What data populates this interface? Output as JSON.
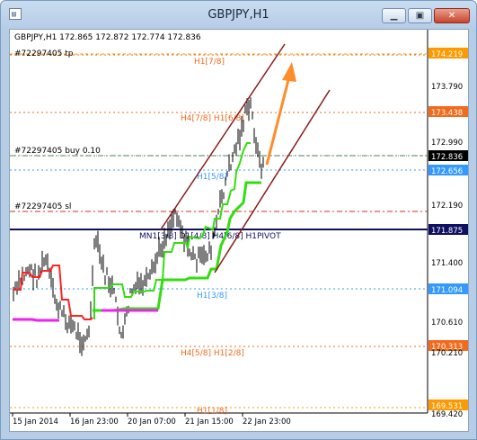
{
  "window": {
    "title": "GBPJPY,H1",
    "minimize_label": "▁",
    "maximize_label": "▣",
    "close_label": "✕",
    "icon": "chart-window-icon"
  },
  "chart": {
    "header": "GBPJPY,H1  172.865 172.872 172.774 172.836",
    "order_tp_label": "#72297405 tp",
    "order_buy_label": "#72297405 buy 0.10",
    "order_sl_label": "#72297405 sl",
    "murrey_labels": {
      "h1_7_8": "H1[7/8]",
      "h4_7_8_h1_6_8": "H4[7/8] H1[6/8]",
      "h1_5_8": "H1[5/8]",
      "mn1_pivot": "MN1[3/8] D1[4/8] H4[6/8] H1PIVOT",
      "h1_3_8": "H1[3/8]",
      "h4_5_8_h1_2_8": "H4[5/8] H1[2/8]",
      "h1_1_8": "H1[1/8]"
    },
    "price_axis": [
      "174.219",
      "173.790",
      "173.438",
      "172.990",
      "172.836",
      "172.656",
      "172.190",
      "171.875",
      "171.400",
      "171.094",
      "170.610",
      "170.313",
      "170.210",
      "169.531",
      "169.420"
    ],
    "time_axis": [
      "15 Jan 2014",
      "16 Jan 23:00",
      "20 Jan 07:00",
      "21 Jan 15:00",
      "22 Jan 23:00"
    ],
    "colors": {
      "tp_line": "#ff9900",
      "murrey_orange": "#f36a1c",
      "buy_line": "#2e8b2e",
      "current_price_line": "#808080",
      "current_price_tag": "#000000",
      "h1_blue": "#3399ff",
      "sl_line": "#cc3311",
      "pivot_line": "#101060",
      "channel_line": "#8b1a1a",
      "arrow": "#ff8c2a",
      "trend_green": "#33dd11",
      "trend_red": "#ff2222",
      "trend_magenta": "#ee22ee",
      "candles": "#000000"
    },
    "icons": [
      "up-arrow-annotation-icon"
    ]
  }
}
